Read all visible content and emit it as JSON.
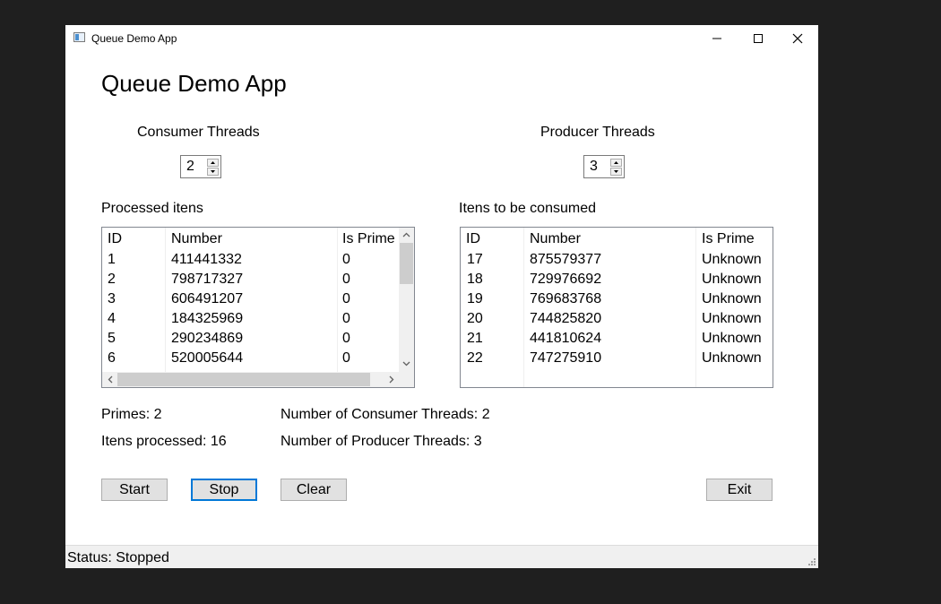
{
  "window": {
    "title": "Queue Demo App"
  },
  "heading": "Queue Demo App",
  "consumer": {
    "label": "Consumer Threads",
    "value": "2"
  },
  "producer": {
    "label": "Producer Threads",
    "value": "3"
  },
  "processed": {
    "label": "Processed itens",
    "columns": [
      "ID",
      "Number",
      "Is Prime"
    ],
    "rows": [
      [
        "1",
        "411441332",
        "0"
      ],
      [
        "2",
        "798717327",
        "0"
      ],
      [
        "3",
        "606491207",
        "0"
      ],
      [
        "4",
        "184325969",
        "0"
      ],
      [
        "5",
        "290234869",
        "0"
      ],
      [
        "6",
        "520005644",
        "0"
      ]
    ]
  },
  "to_consume": {
    "label": "Itens to be consumed",
    "columns": [
      "ID",
      "Number",
      "Is Prime"
    ],
    "rows": [
      [
        "17",
        "875579377",
        "Unknown"
      ],
      [
        "18",
        "729976692",
        "Unknown"
      ],
      [
        "19",
        "769683768",
        "Unknown"
      ],
      [
        "20",
        "744825820",
        "Unknown"
      ],
      [
        "21",
        "441810624",
        "Unknown"
      ],
      [
        "22",
        "747275910",
        "Unknown"
      ]
    ]
  },
  "stats": {
    "primes": "Primes: 2",
    "processed": "Itens processed: 16",
    "consumer_threads": "Number of Consumer Threads: 2",
    "producer_threads": "Number of Producer Threads: 3"
  },
  "buttons": {
    "start": "Start",
    "stop": "Stop",
    "clear": "Clear",
    "exit": "Exit"
  },
  "status": "Status: Stopped",
  "colors": {
    "focus_border": "#0078d7",
    "button_bg": "#e1e1e1",
    "status_bg": "#f0f0f0"
  }
}
